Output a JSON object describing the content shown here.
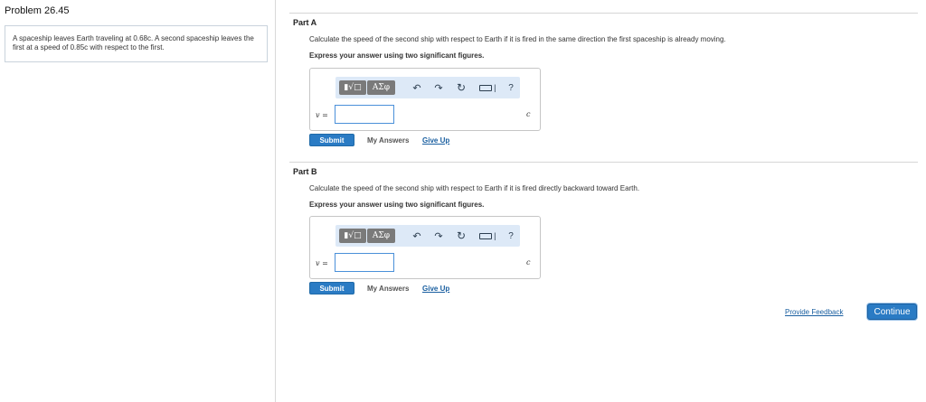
{
  "problem": {
    "title": "Problem 26.45",
    "text": "A spaceship leaves Earth traveling at 0.68c. A second spaceship leaves the first at a speed of 0.85c with respect to the first."
  },
  "parts": [
    {
      "title": "Part A",
      "question": "Calculate the speed of the second ship with respect to Earth if it is fired in the same direction the first spaceship is already moving.",
      "instruction": "Express your answer using two significant figures.",
      "variable": "v =",
      "unit": "c",
      "input_value": "",
      "submit_label": "Submit",
      "my_answers_label": "My Answers",
      "give_up_label": "Give Up"
    },
    {
      "title": "Part B",
      "question": "Calculate the speed of the second ship with respect to Earth if it is fired directly backward toward Earth.",
      "instruction": "Express your answer using two significant figures.",
      "variable": "v =",
      "unit": "c",
      "input_value": "",
      "submit_label": "Submit",
      "my_answers_label": "My Answers",
      "give_up_label": "Give Up"
    }
  ],
  "toolbar": {
    "sqrt_label": "▮√□",
    "greek_label": "ΑΣφ",
    "undo_icon": "undo-icon",
    "redo_icon": "redo-icon",
    "reset_icon": "reset-icon",
    "keyboard_icon": "keyboard-icon",
    "help_label": "?"
  },
  "footer": {
    "feedback_label": "Provide Feedback",
    "continue_label": "Continue"
  },
  "colors": {
    "accent": "#2a7bc4",
    "link": "#1a5fa0",
    "toolbar_bg": "#dde9f7"
  }
}
